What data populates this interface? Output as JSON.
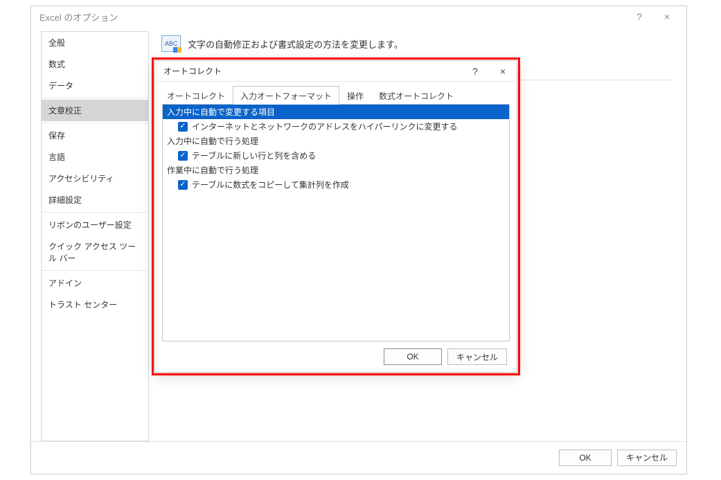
{
  "outer": {
    "title": "Excel のオプション",
    "help": "?",
    "close": "×",
    "ok": "OK",
    "cancel": "キャンセル"
  },
  "sidebar": {
    "items": [
      "全般",
      "数式",
      "データ",
      "文章校正",
      "保存",
      "言語",
      "アクセシビリティ",
      "詳細設定",
      "リボンのユーザー設定",
      "クイック アクセス ツール バー",
      "アドイン",
      "トラスト センター"
    ],
    "selected_index": 3
  },
  "content": {
    "abc_label": "ABC",
    "header_text": "文字の自動修正および書式設定の方法を変更します。"
  },
  "inner": {
    "title": "オートコレクト",
    "help": "?",
    "close": "×",
    "tabs": [
      "オートコレクト",
      "入力オートフォーマット",
      "操作",
      "数式オートコレクト"
    ],
    "active_tab": 1,
    "sections": {
      "s1_title": "入力中に自動で変更する項目",
      "s1_chk1": "インターネットとネットワークのアドレスをハイパーリンクに変更する",
      "s2_title": "入力中に自動で行う処理",
      "s2_chk1": "テーブルに新しい行と列を含める",
      "s3_title": "作業中に自動で行う処理",
      "s3_chk1": "テーブルに数式をコピーして集計列を作成"
    },
    "ok": "OK",
    "cancel": "キャンセル"
  }
}
